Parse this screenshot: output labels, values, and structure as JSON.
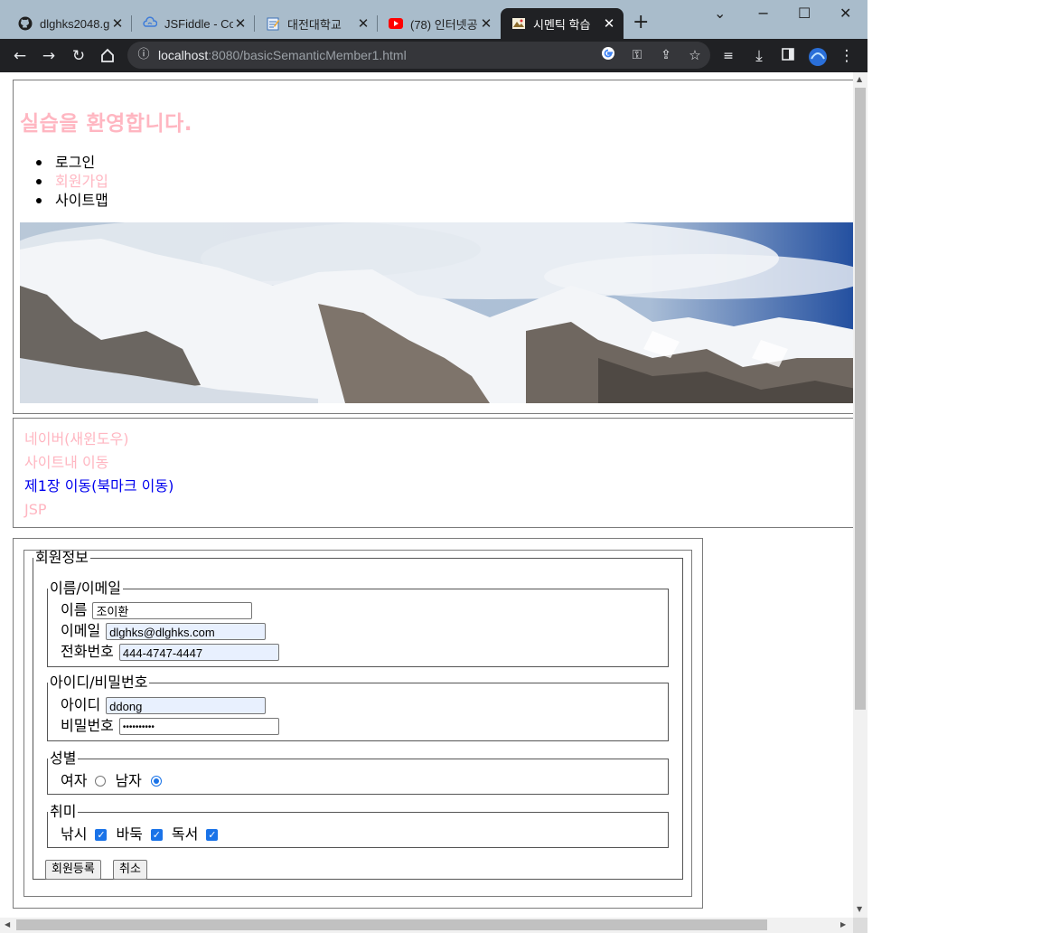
{
  "browser": {
    "tabs": [
      {
        "title": "dlghks2048.g",
        "favicon": "github-icon"
      },
      {
        "title": "JSFiddle - Co",
        "favicon": "jsfiddle-icon"
      },
      {
        "title": "대전대학교",
        "favicon": "notepad-icon"
      },
      {
        "title": "(78) 인터넷공",
        "favicon": "youtube-icon"
      },
      {
        "title": "시멘틱 학습",
        "favicon": "page-icon"
      }
    ],
    "url_host": "localhost",
    "url_rest": ":8080/basicSemanticMember1.html"
  },
  "page": {
    "title": "실습을 환영합니다.",
    "menu": [
      "로그인",
      "회원가입",
      "사이트맵"
    ],
    "links": [
      "네이버(새윈도우)",
      "사이트내 이동",
      "제1장 이동(북마크 이동)",
      "JSP"
    ],
    "form": {
      "legend": "회원정보",
      "name_email": {
        "legend": "이름/이메일",
        "name_label": "이름",
        "name_value": "조이환",
        "email_label": "이메일",
        "email_value": "dlghks@dlghks.com",
        "phone_label": "전화번호",
        "phone_value": "444-4747-4447"
      },
      "id_pw": {
        "legend": "아이디/비밀번호",
        "id_label": "아이디",
        "id_value": "ddong",
        "pw_label": "비밀번호",
        "pw_value": "••••••••••"
      },
      "gender": {
        "legend": "성별",
        "female_label": "여자",
        "male_label": "남자",
        "selected": "남자"
      },
      "hobby": {
        "legend": "취미",
        "items": [
          "낚시",
          "바둑",
          "독서"
        ],
        "checked": [
          true,
          true,
          true
        ]
      },
      "submit_label": "회원등록",
      "cancel_label": "취소"
    }
  },
  "colors": {
    "pink": "#ffb6c1",
    "link_blue": "#0000ee",
    "tab_active": "#202124",
    "tabstrip": "#a9bccb"
  }
}
